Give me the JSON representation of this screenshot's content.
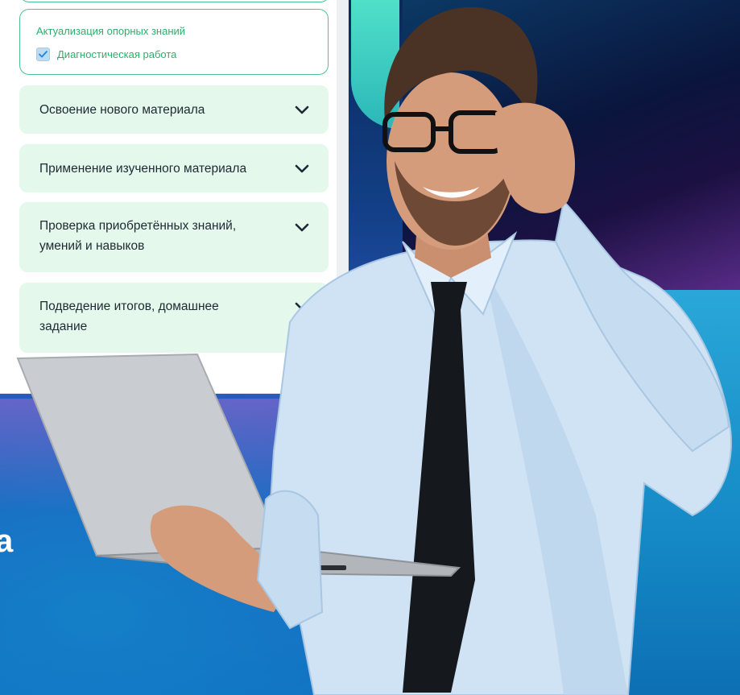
{
  "lesson": {
    "expanded_section": {
      "subtitle": "Актуализация опорных знаний",
      "items": [
        {
          "label": "Диагностическая работа",
          "checked": true
        }
      ]
    },
    "sections": [
      {
        "title": "Освоение нового материала",
        "icon": "chevron-down-icon"
      },
      {
        "title": "Применение изученного материала",
        "icon": "chevron-down-icon"
      },
      {
        "title": "Проверка приобретённых знаний, умений и навыков",
        "icon": "chevron-down-icon"
      },
      {
        "title": "Подведение итогов, домашнее задание",
        "icon": "chevron-down-icon"
      }
    ]
  },
  "background": {
    "partial_letter": "a"
  },
  "colors": {
    "accent_green": "#2fae6b",
    "card_bg": "#e4f8ec",
    "card_border": "#4cc58f",
    "checkbox_fill": "#b9dcf7",
    "text_dark": "#1d2a33"
  }
}
